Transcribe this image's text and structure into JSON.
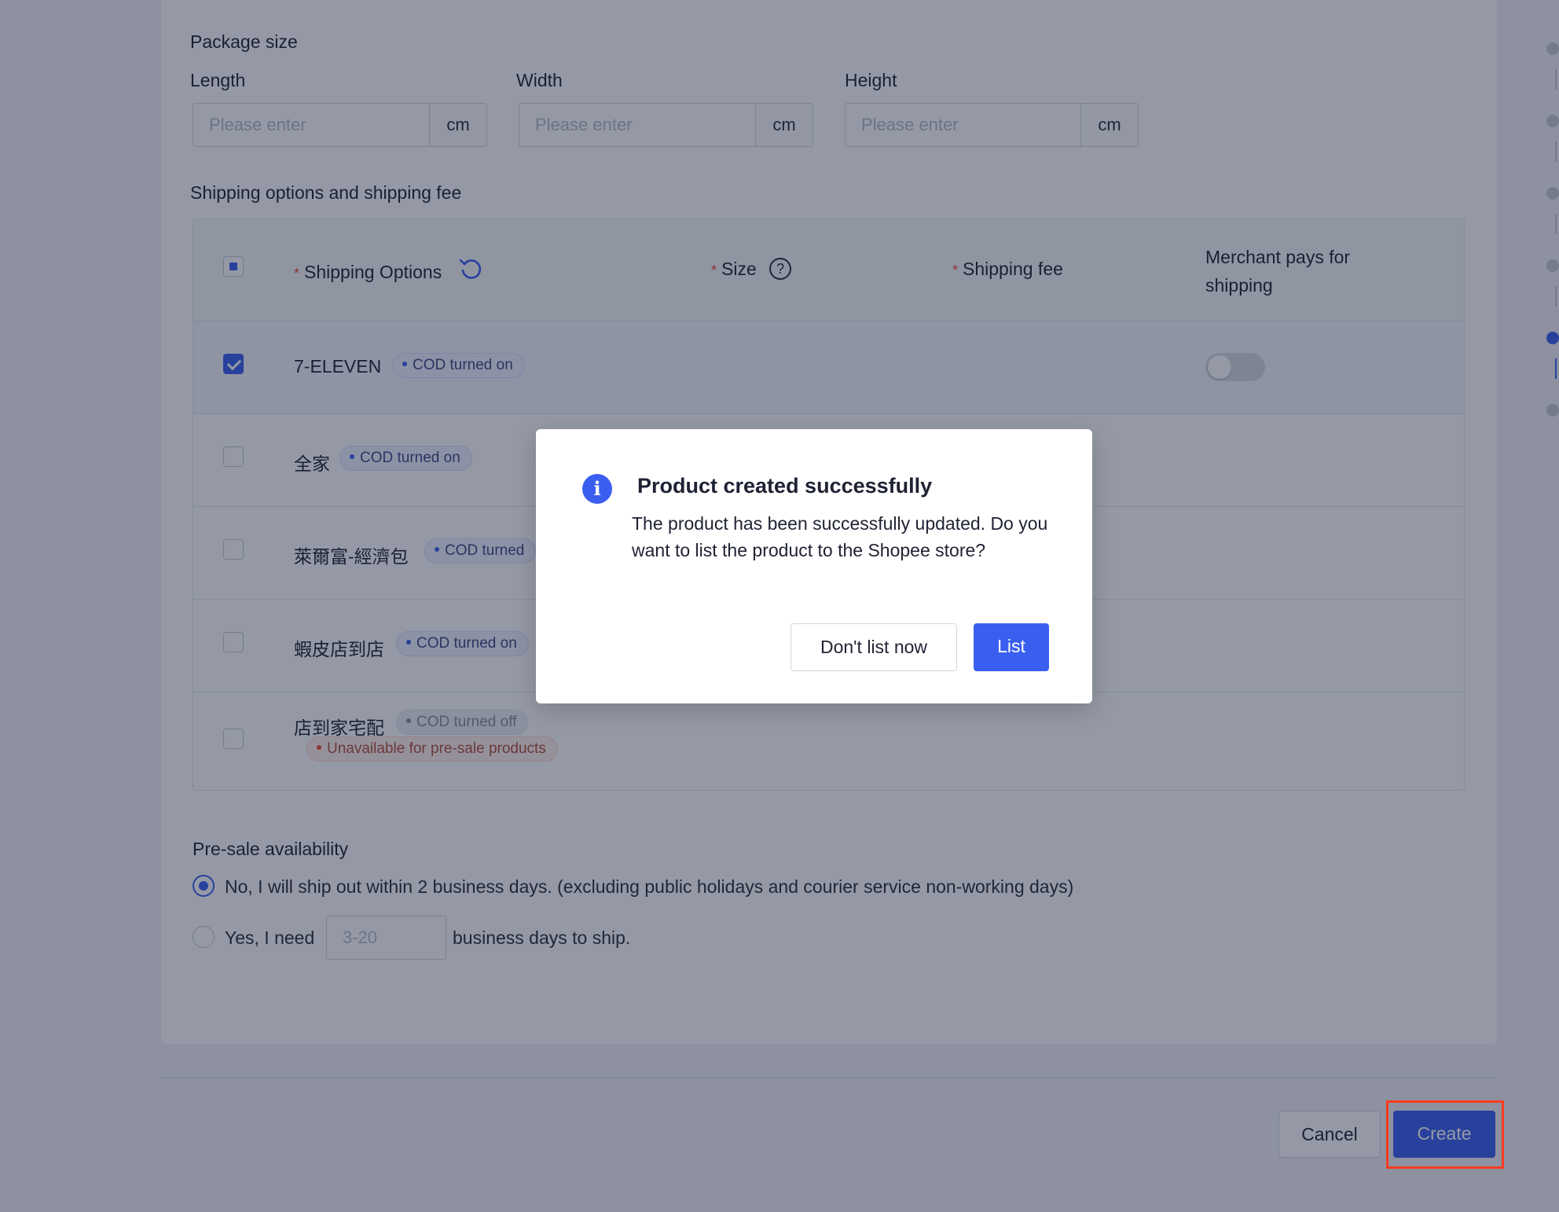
{
  "package": {
    "title": "Package size",
    "fields": [
      {
        "label": "Length",
        "placeholder": "Please enter",
        "unit": "cm"
      },
      {
        "label": "Width",
        "placeholder": "Please enter",
        "unit": "cm"
      },
      {
        "label": "Height",
        "placeholder": "Please enter",
        "unit": "cm"
      }
    ]
  },
  "shipping": {
    "title": "Shipping options and shipping fee",
    "headers": {
      "options": "Shipping Options",
      "size": "Size",
      "fee": "Shipping fee",
      "merchant_pays": "Merchant pays for shipping",
      "required_mark": "*"
    },
    "rows": [
      {
        "name": "7-ELEVEN",
        "tag": "COD turned on",
        "checked": true,
        "merchant_pays": false
      },
      {
        "name": "全家",
        "tag": "COD turned on",
        "checked": false
      },
      {
        "name": "萊爾富-經濟包",
        "tag": "COD turned",
        "checked": false
      },
      {
        "name": "蝦皮店到店",
        "tag": "COD turned on",
        "checked": false
      },
      {
        "name": "店到家宅配",
        "tag": "COD turned off",
        "extra_tag": "Unavailable for pre-sale products",
        "checked": false
      }
    ]
  },
  "presale": {
    "title": "Pre-sale availability",
    "option_no": "No, I will ship out within 2 business days. (excluding public holidays and courier service non-working days)",
    "option_yes_prefix": "Yes, I need",
    "days_placeholder": "3-20",
    "option_yes_suffix": "business days to ship.",
    "selected": "no"
  },
  "footer": {
    "cancel_label": "Cancel",
    "create_label": "Create"
  },
  "modal": {
    "title": "Product created successfully",
    "body": "The product has been successfully updated. Do you want to list the product to the Shopee store?",
    "secondary_label": "Don't list now",
    "primary_label": "List",
    "icon": "info-icon"
  },
  "colors": {
    "primary": "#3a5ff0",
    "danger": "#ee4d2d",
    "highlight": "#ff3b1f"
  }
}
